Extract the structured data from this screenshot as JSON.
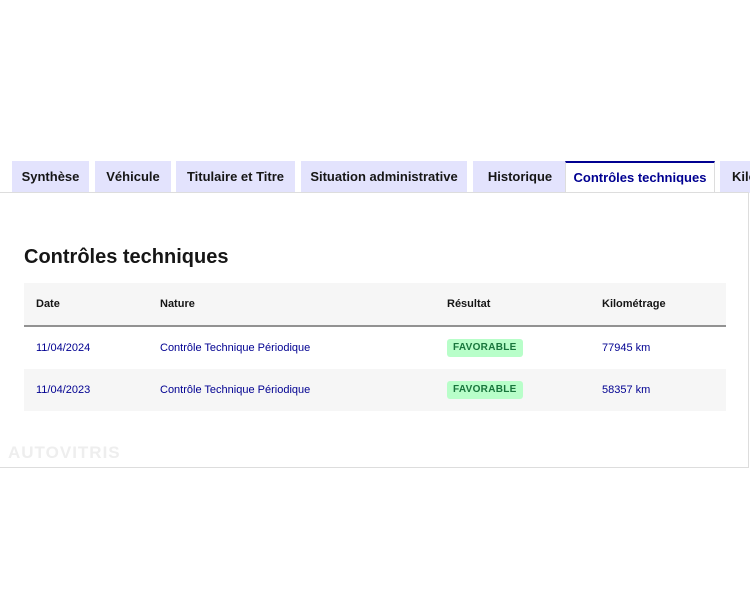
{
  "tabs": [
    {
      "label": "Synthèse"
    },
    {
      "label": "Véhicule"
    },
    {
      "label": "Titulaire et Titre"
    },
    {
      "label": "Situation administrative"
    },
    {
      "label": "Historique"
    },
    {
      "label": "Contrôles techniques",
      "active": true
    },
    {
      "label": "Kilo"
    }
  ],
  "section": {
    "title": "Contrôles techniques"
  },
  "table": {
    "headers": [
      "Date",
      "Nature",
      "Résultat",
      "Kilométrage"
    ],
    "rows": [
      {
        "date": "11/04/2024",
        "nature": "Contrôle Technique Périodique",
        "result": "FAVORABLE",
        "mileage": "77945 km"
      },
      {
        "date": "11/04/2023",
        "nature": "Contrôle Technique Périodique",
        "result": "FAVORABLE",
        "mileage": "58357 km"
      }
    ]
  },
  "watermark": "AUTOVITRIS",
  "colors": {
    "accent": "#000091",
    "tab_bg": "#e3e3fd",
    "badge_bg": "#b8fec9",
    "badge_text": "#18753c"
  }
}
